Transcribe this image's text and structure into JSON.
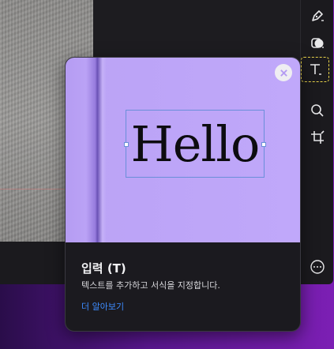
{
  "toolbar": {
    "tools": [
      {
        "name": "pen-tool",
        "icon": "pen-icon"
      },
      {
        "name": "shape-tool",
        "icon": "shapes-icon"
      },
      {
        "name": "text-tool",
        "icon": "text-icon",
        "active": true
      },
      {
        "name": "zoom-tool",
        "icon": "search-icon"
      },
      {
        "name": "crop-tool",
        "icon": "crop-icon"
      },
      {
        "name": "more-tool",
        "icon": "more-icon"
      }
    ],
    "active_outline_color": "#e8d24a"
  },
  "popover": {
    "preview_text": "Hello",
    "title": "입력 (T)",
    "description": "텍스트를 추가하고 서식을 지정합니다.",
    "learn_more": "더 알아보기",
    "preview_color": "#bba3f6",
    "link_color": "#3d8bff"
  }
}
